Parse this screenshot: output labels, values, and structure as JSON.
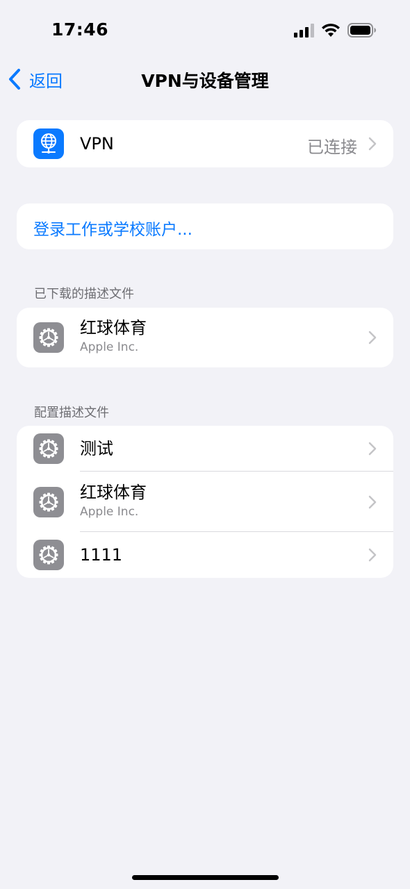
{
  "status_bar": {
    "time": "17:46"
  },
  "nav": {
    "back_label": "返回",
    "title": "VPN与设备管理"
  },
  "vpn_row": {
    "label": "VPN",
    "value": "已连接"
  },
  "login_row": {
    "label": "登录工作或学校账户..."
  },
  "downloaded_section": {
    "header": "已下载的描述文件",
    "items": [
      {
        "title": "红球体育",
        "subtitle": "Apple Inc."
      }
    ]
  },
  "config_section": {
    "header": "配置描述文件",
    "items": [
      {
        "title": "测试"
      },
      {
        "title": "红球体育",
        "subtitle": "Apple Inc."
      },
      {
        "title": "1111"
      }
    ]
  },
  "colors": {
    "accent": "#0a7aff",
    "background": "#f2f2f7",
    "icon_gray": "#8e8e93"
  },
  "icons": [
    "signal-icon",
    "wifi-icon",
    "battery-icon",
    "back-chevron-icon",
    "vpn-globe-icon",
    "gear-icon",
    "chevron-right-icon"
  ]
}
